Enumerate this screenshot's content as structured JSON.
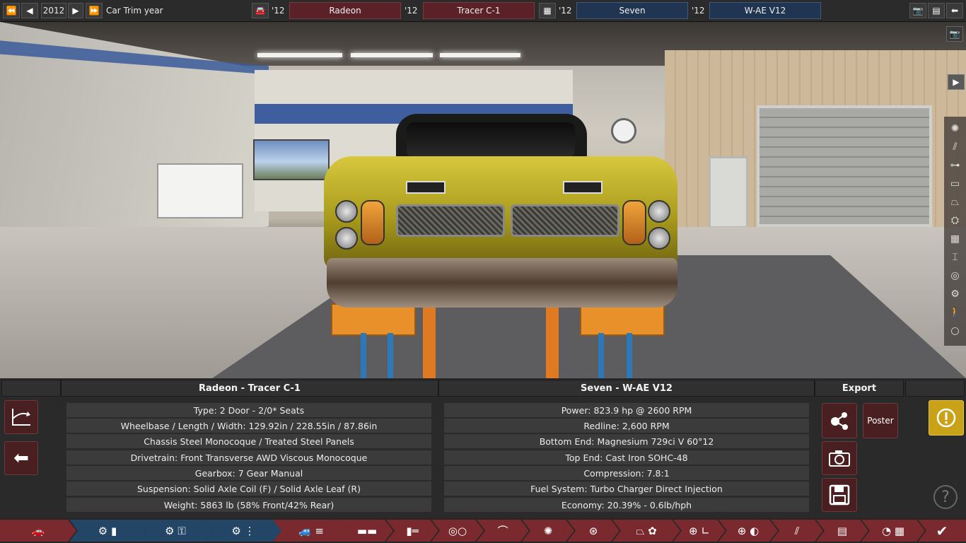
{
  "topbar": {
    "year_value": "2012",
    "year_label": "Car Trim year",
    "car_year": "'12",
    "car_model": "Radeon",
    "car_trim_year": "'12",
    "car_trim": "Tracer C-1",
    "engine_year": "'12",
    "engine_family": "Seven",
    "engine_variant_year": "'12",
    "engine_variant": "W-AE V12",
    "icons": [
      "rewind-icon",
      "step-back-icon",
      "step-forward-icon",
      "fast-forward-icon",
      "car-icon",
      "engine-icon",
      "camera-icon",
      "list-icon",
      "back-arrow-icon"
    ]
  },
  "car_info": {
    "header": "Radeon - Tracer C-1",
    "rows": [
      "Type: 2 Door - 2/0* Seats",
      "Wheelbase / Length / Width: 129.92in / 228.55in / 87.86in",
      "Chassis Steel Monocoque / Treated Steel Panels",
      "Drivetrain: Front Transverse AWD Viscous Monocoque",
      "Gearbox: 7 Gear Manual",
      "Suspension: Solid Axle Coil (F) / Solid Axle Leaf (R)",
      "Weight: 5863 lb (58% Front/42% Rear)"
    ]
  },
  "engine_info": {
    "header": "Seven - W-AE V12",
    "rows": [
      "Power: 823.9 hp @ 2600 RPM",
      "Redline:  2,600 RPM",
      "Bottom End: Magnesium 729ci V 60°12",
      "Top End: Cast Iron SOHC-48",
      "Compression: 7.8:1",
      "Fuel System: Turbo Charger Direct Injection",
      "Economy: 20.39% - 0.6lb/hph"
    ]
  },
  "export": {
    "header": "Export",
    "poster_label": "Poster"
  },
  "help_symbol": "?",
  "bottom_tabs": [
    {
      "name": "car-body-tab",
      "glyph": "🚗"
    },
    {
      "name": "engine-family-tab",
      "glyph": "⚙ ▮"
    },
    {
      "name": "engine-variant-tab",
      "glyph": "⚙ ⚿"
    },
    {
      "name": "engine-tune-tab",
      "glyph": "⚙ ⋮"
    },
    {
      "name": "car-model-tab",
      "glyph": "🚙 ≡"
    },
    {
      "name": "chassis-tab",
      "glyph": "▬▬"
    },
    {
      "name": "drivetrain-tab",
      "glyph": "▮═"
    },
    {
      "name": "body-tab",
      "glyph": "◎○"
    },
    {
      "name": "suspension-tab",
      "glyph": "⌒"
    },
    {
      "name": "wheels-tab",
      "glyph": "✺"
    },
    {
      "name": "brakes-tab",
      "glyph": "⊛"
    },
    {
      "name": "aero-tab",
      "glyph": "⏢ ✿"
    },
    {
      "name": "interior-tab",
      "glyph": "⊕ ∟"
    },
    {
      "name": "test-track-tab",
      "glyph": "⊕ ◐"
    },
    {
      "name": "tuning-tab",
      "glyph": "⫽"
    },
    {
      "name": "spec-sheet-tab",
      "glyph": "▤"
    },
    {
      "name": "race-tab",
      "glyph": "◔ ▦"
    },
    {
      "name": "finish-tab",
      "glyph": "✔"
    }
  ]
}
